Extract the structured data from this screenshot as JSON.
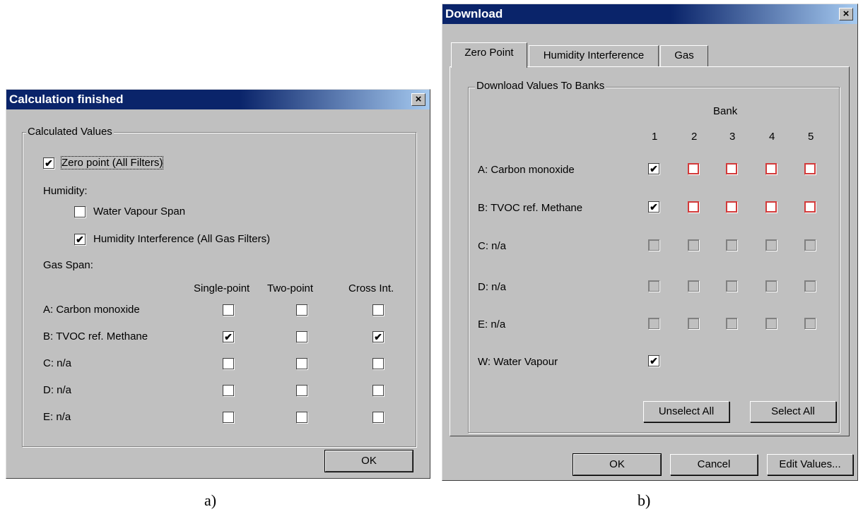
{
  "calc": {
    "title": "Calculation finished",
    "close": "×",
    "group_label": "Calculated Values",
    "zero_point": {
      "label": "Zero point (All Filters)",
      "checked": true
    },
    "humidity_label": "Humidity:",
    "humidity_items": [
      {
        "label": "Water Vapour Span",
        "checked": false
      },
      {
        "label": "Humidity Interference (All Gas Filters)",
        "checked": true
      }
    ],
    "gas_span_label": "Gas Span:",
    "columns": [
      "Single-point",
      "Two-point",
      "Cross Int."
    ],
    "rows": [
      {
        "label": "A: Carbon monoxide",
        "checks": [
          false,
          false,
          false
        ]
      },
      {
        "label": "B: TVOC ref. Methane",
        "checks": [
          true,
          false,
          true
        ]
      },
      {
        "label": "C: n/a",
        "checks": [
          false,
          false,
          false
        ]
      },
      {
        "label": "D: n/a",
        "checks": [
          false,
          false,
          false
        ]
      },
      {
        "label": "E: n/a",
        "checks": [
          false,
          false,
          false
        ]
      }
    ],
    "ok": "OK"
  },
  "download": {
    "title": "Download",
    "close": "×",
    "tabs": [
      "Zero Point",
      "Humidity Interference",
      "Gas"
    ],
    "group_label": "Download Values To Banks",
    "bank_label": "Bank",
    "bank_numbers": [
      "1",
      "2",
      "3",
      "4",
      "5"
    ],
    "rows": [
      {
        "label": "A: Carbon monoxide",
        "checks": [
          "checked",
          "red",
          "red",
          "red",
          "red"
        ]
      },
      {
        "label": "B: TVOC ref. Methane",
        "checks": [
          "checked",
          "red",
          "red",
          "red",
          "red"
        ]
      },
      {
        "label": "C: n/a",
        "checks": [
          "disabled",
          "disabled",
          "disabled",
          "disabled",
          "disabled"
        ]
      },
      {
        "label": "D: n/a",
        "checks": [
          "disabled",
          "disabled",
          "disabled",
          "disabled",
          "disabled"
        ]
      },
      {
        "label": "E: n/a",
        "checks": [
          "disabled",
          "disabled",
          "disabled",
          "disabled",
          "disabled"
        ]
      },
      {
        "label": "W: Water Vapour",
        "checks": [
          "checked"
        ]
      }
    ],
    "unselect_all": "Unselect All",
    "select_all": "Select All",
    "ok": "OK",
    "cancel": "Cancel",
    "edit_values": "Edit Values..."
  },
  "captions": {
    "a": "a)",
    "b": "b)"
  },
  "check_glyph": "✔"
}
